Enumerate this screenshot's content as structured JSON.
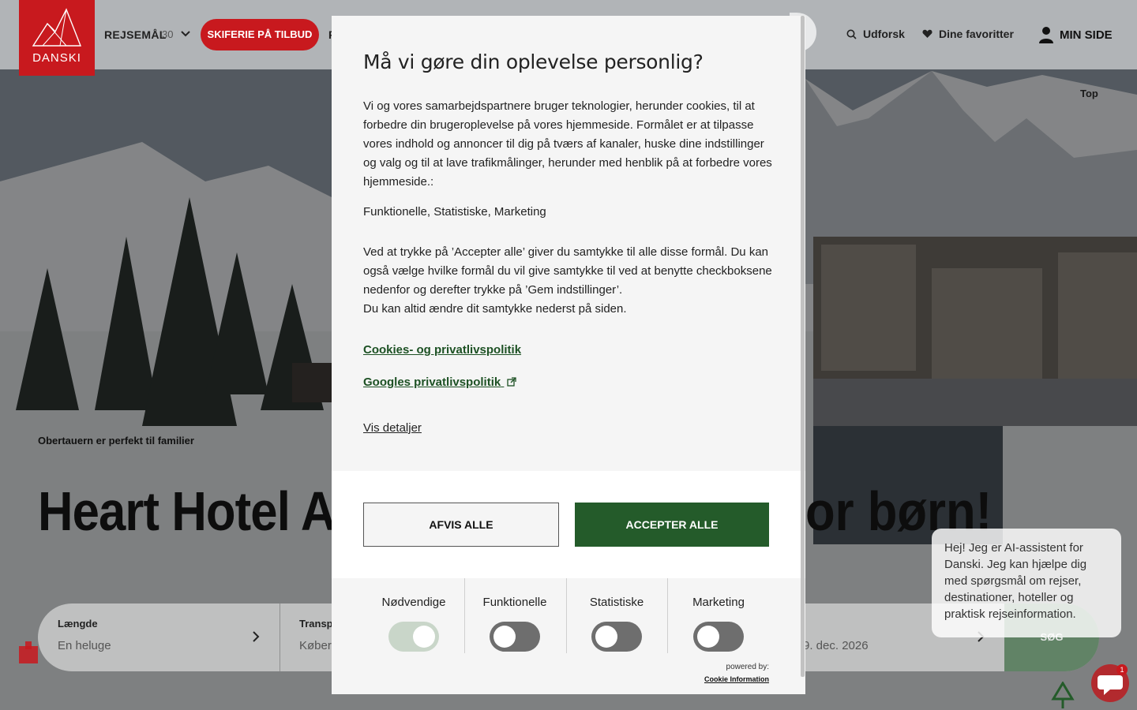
{
  "header": {
    "logo_text": "DANSKI",
    "nav_destinations": "REJSEMÅL",
    "nav_destinations_count": "30",
    "offer_button": "SKIFERIE PÅ TILBUD",
    "nav_cut_text": "F",
    "explore": "Udforsk",
    "favorites": "Dine favoritter",
    "my_page": "MIN SIDE",
    "brand_color": "#c8191e"
  },
  "hero": {
    "top_label": "Top",
    "subtitle": "Obertauern er perfekt til familier",
    "title_left": "Heart Hotel Au",
    "title_right": "or børn!"
  },
  "search_bar": {
    "fields": [
      {
        "label": "Længde",
        "value": "En heluge"
      },
      {
        "label": "Transp",
        "value": "Køber"
      },
      {
        "label": "",
        "value": "9. dec. 2026"
      }
    ],
    "search_button": "SØG"
  },
  "chat": {
    "message": "Hej! Jeg er AI-assistent for Danski. Jeg kan hjælpe dig med spørgsmål om rejser, destinationer, hoteller og praktisk rejseinformation.",
    "badge_count": "1"
  },
  "consent": {
    "title": "Må vi gøre din oplevelse personlig?",
    "body": "Vi og vores samarbejdspartnere bruger teknologier, herunder cookies, til at forbedre din brugeroplevelse på vores hjemmeside. Formålet er at tilpasse vores indhold og annoncer til dig på tværs af kanaler, huske dine indstillinger og valg og til at lave trafikmålinger, herunder med henblik på at forbedre vores hjemmeside.:",
    "purposes": "Funktionelle, Statistiske, Marketing",
    "body2_line1": "Ved at trykke på ’Accepter alle’ giver du samtykke til alle disse formål. Du kan også vælge hvilke formål du vil give samtykke til ved at benytte checkboksene nedenfor og derefter trykke på ’Gem indstillinger’.",
    "body2_line2": "Du kan altid ændre dit samtykke nederst på siden.",
    "link_cookies": "Cookies- og privatlivspolitik",
    "link_google": "Googles privatlivspolitik",
    "show_details": "Vis detaljer",
    "reject_button": "AFVIS ALLE",
    "accept_button": "ACCEPTER ALLE",
    "accent_color": "#245b2a",
    "toggles": [
      {
        "label": "Nødvendige",
        "on": true
      },
      {
        "label": "Funktionelle",
        "on": false
      },
      {
        "label": "Statistiske",
        "on": false
      },
      {
        "label": "Marketing",
        "on": false
      }
    ],
    "powered_by": "powered by:",
    "powered_link": "Cookie Information"
  }
}
